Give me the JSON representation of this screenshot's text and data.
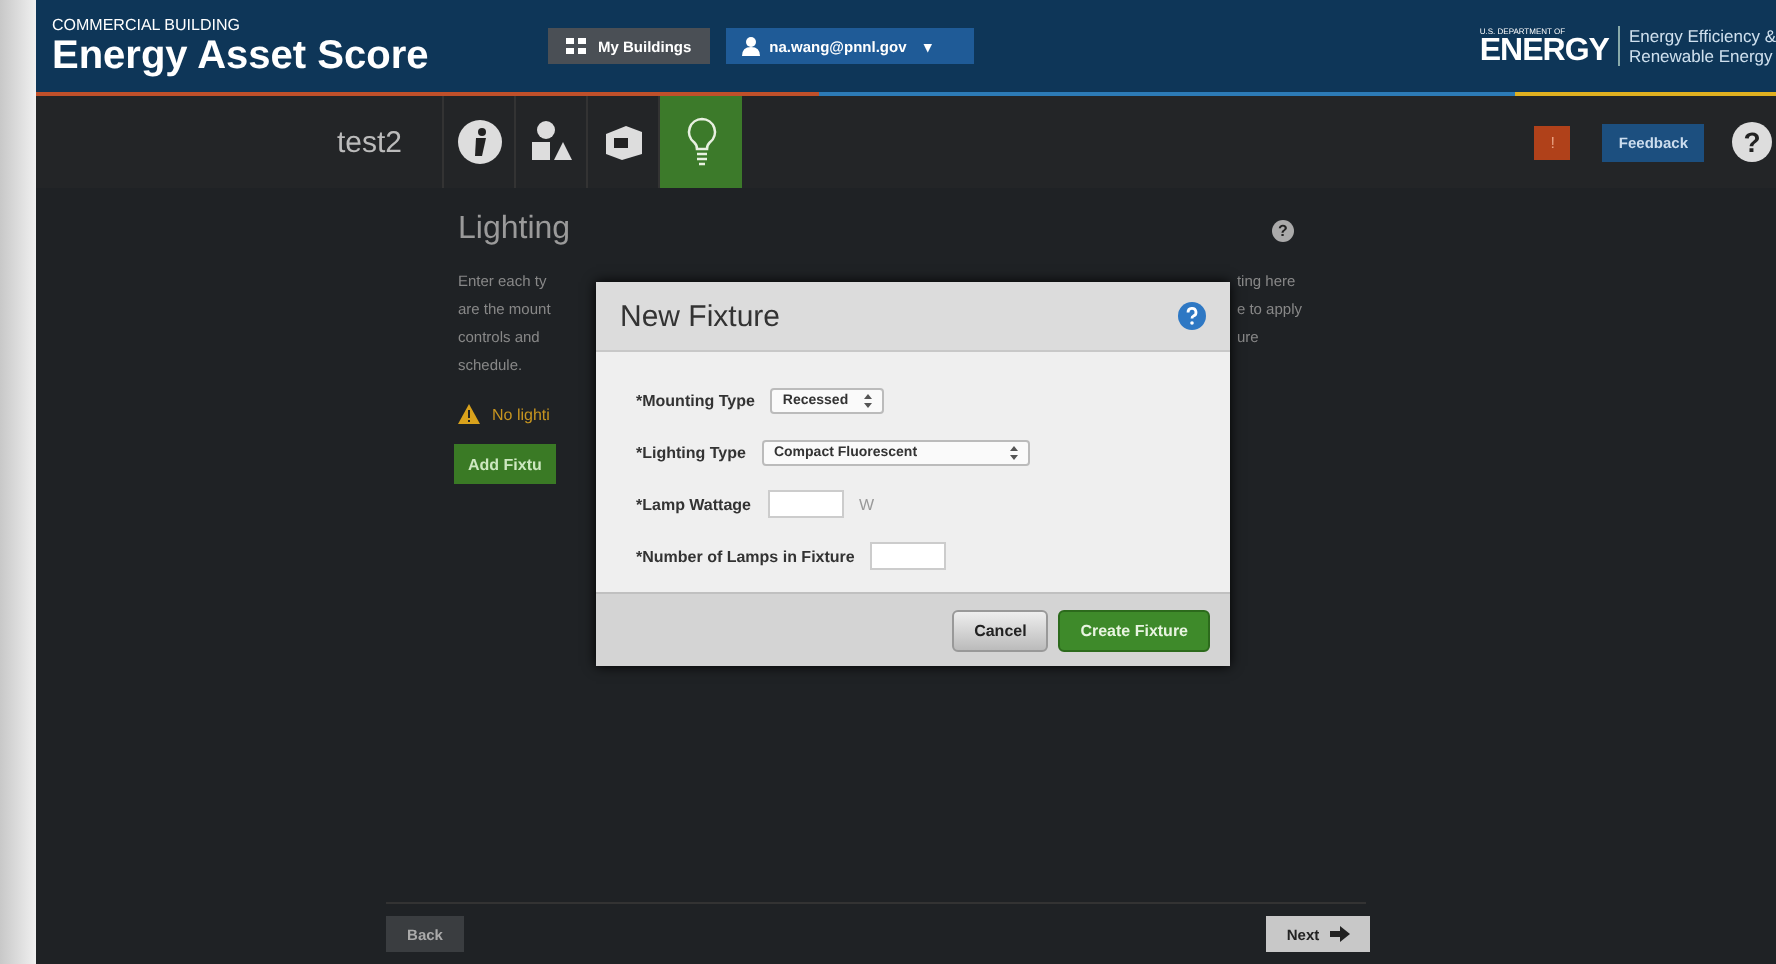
{
  "header": {
    "subtitle": "COMMERCIAL BUILDING",
    "title": "Energy Asset Score",
    "buttons": [
      {
        "kind": "buildings",
        "label": "My Buildings"
      },
      {
        "kind": "user",
        "label": "na.wang@pnnl.gov",
        "caret": "▾"
      }
    ],
    "doe": {
      "small": "U.S. DEPARTMENT OF",
      "big": "ENERGY",
      "office_lines": [
        "Energy Efficiency &",
        "Renewable Energy"
      ]
    }
  },
  "subnav": {
    "building": "test2",
    "tabs": [
      {
        "kind": "info",
        "selected": false
      },
      {
        "kind": "shapes",
        "selected": false
      },
      {
        "kind": "envelope",
        "selected": false
      },
      {
        "kind": "lighting",
        "selected": true
      }
    ],
    "alert": "!",
    "feedback": "Feedback",
    "help": "?"
  },
  "page": {
    "title": "Lighting",
    "help": "?",
    "intro_left": [
      "Enter each ty",
      "are the mount",
      "controls and",
      "schedule."
    ],
    "intro_right": [
      "ting here",
      "e to apply",
      "ure"
    ],
    "warning": "No lighti",
    "add_button": "Add Fixtu",
    "back": "Back",
    "next": "Next"
  },
  "dialog": {
    "title": "New Fixture",
    "fields": [
      {
        "kind": "select",
        "label": "*Mounting Type",
        "value": "Recessed",
        "wide": false
      },
      {
        "kind": "select",
        "label": "*Lighting Type",
        "value": "Compact Fluorescent",
        "wide": true
      },
      {
        "kind": "input",
        "label": "*Lamp Wattage",
        "unit": "W"
      },
      {
        "kind": "input",
        "label": "*Number of Lamps in Fixture"
      }
    ],
    "cancel": "Cancel",
    "create": "Create Fixture"
  }
}
